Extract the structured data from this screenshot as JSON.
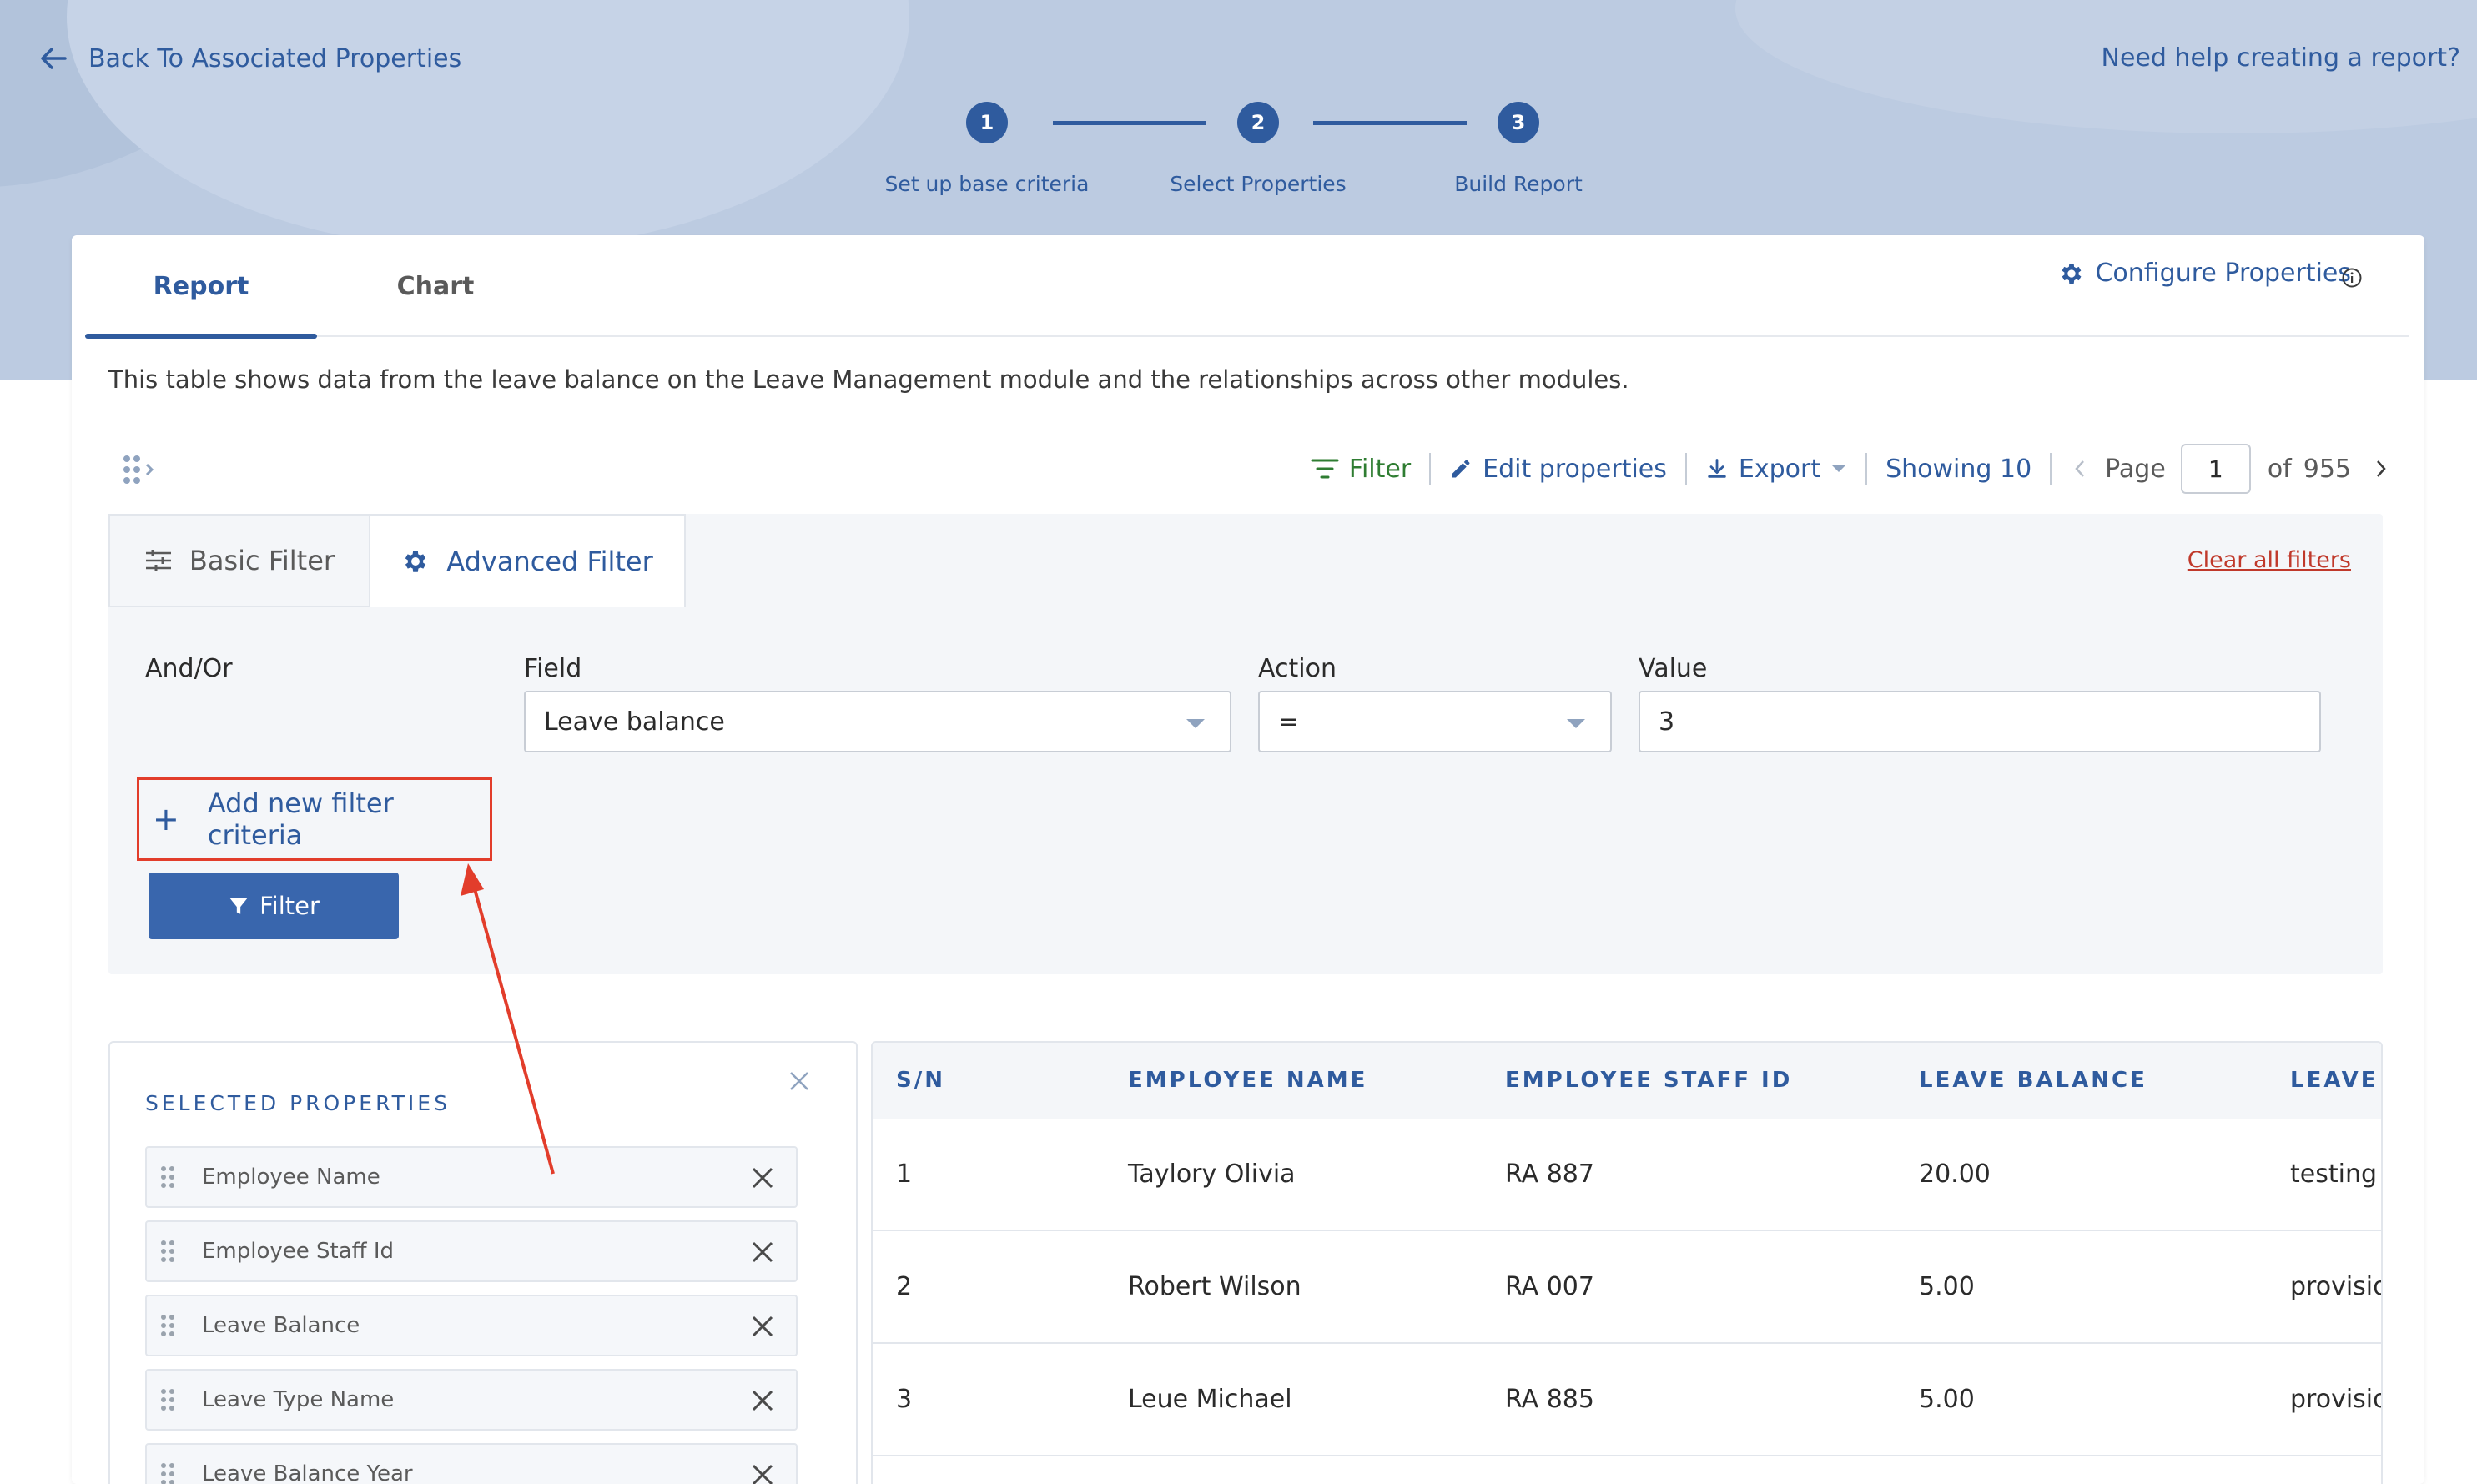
{
  "header": {
    "back_label": "Back To Associated Properties",
    "help_label": "Need help creating a report?"
  },
  "stepper": {
    "steps": [
      {
        "number": "1",
        "label": "Set up base criteria"
      },
      {
        "number": "2",
        "label": "Select Properties"
      },
      {
        "number": "3",
        "label": "Build Report"
      }
    ]
  },
  "tabs": [
    {
      "label": "Report",
      "active": true
    },
    {
      "label": "Chart",
      "active": false
    }
  ],
  "configure_label": "Configure Properties",
  "description": "This table shows data from the leave balance on the Leave Management module and the relationships across other modules.",
  "toolbar": {
    "filter_label": "Filter",
    "edit_label": "Edit properties",
    "export_label": "Export",
    "showing_label": "Showing 10",
    "page_label": "Page",
    "page_value": "1",
    "of_label": "of",
    "total_pages": "955"
  },
  "filter_panel": {
    "basic_tab": "Basic Filter",
    "advanced_tab": "Advanced Filter",
    "clear_all": "Clear all filters",
    "and_or_label": "And/Or",
    "field_label": "Field",
    "field_value": "Leave balance",
    "action_label": "Action",
    "action_value": "=",
    "value_label": "Value",
    "value_value": "3",
    "add_criteria": "Add new filter criteria",
    "filter_button": "Filter"
  },
  "selected_properties": {
    "title": "SELECTED PROPERTIES",
    "items": [
      "Employee Name",
      "Employee Staff Id",
      "Leave Balance",
      "Leave Type Name",
      "Leave Balance Year"
    ]
  },
  "table": {
    "headers": [
      "S/N",
      "EMPLOYEE NAME",
      "EMPLOYEE STAFF ID",
      "LEAVE BALANCE",
      "LEAVE T"
    ],
    "rows": [
      [
        "1",
        "Taylory Olivia",
        "RA 887",
        "20.00",
        "testing l"
      ],
      [
        "2",
        "Robert Wilson",
        "RA 007",
        "5.00",
        "provisior"
      ],
      [
        "3",
        "Leue Michael",
        "RA 885",
        "5.00",
        "provisior"
      ]
    ]
  },
  "colors": {
    "primary": "#2f5b9e",
    "hero_bg": "#bccbe1",
    "annotation": "#e23d2b",
    "filter_green": "#2f7d32",
    "danger": "#c0392b"
  }
}
